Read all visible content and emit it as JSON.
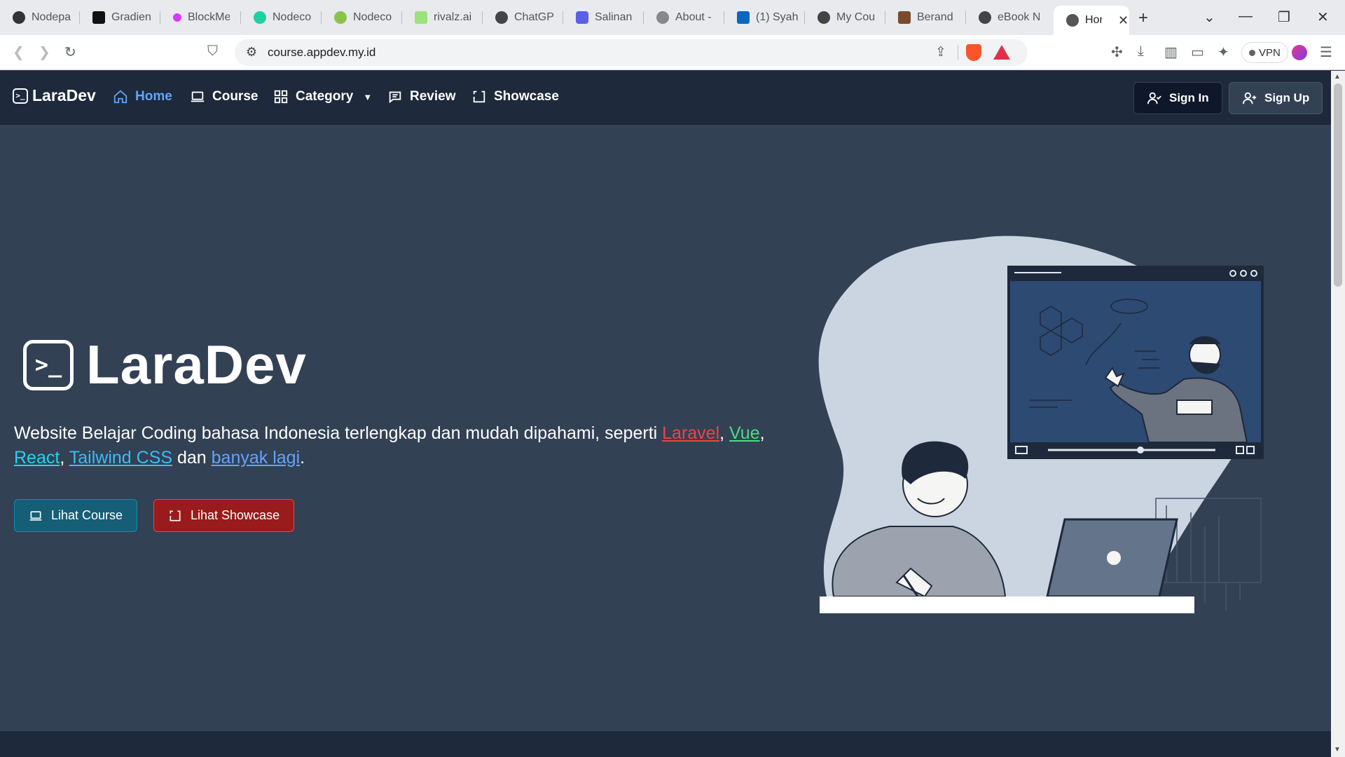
{
  "browser": {
    "tabs": [
      {
        "title": "Nodepa",
        "color": "#333333"
      },
      {
        "title": "Gradien",
        "color": "#111111"
      },
      {
        "title": "BlockMe",
        "color": "#d63aff"
      },
      {
        "title": "Nodeco",
        "color": "#1dd1a1"
      },
      {
        "title": "Nodeco",
        "color": "#8bc34a"
      },
      {
        "title": "rivalz.ai",
        "color": "#9be27a"
      },
      {
        "title": "ChatGP",
        "color": "#444444"
      },
      {
        "title": "Salinan",
        "color": "#5b5fe8"
      },
      {
        "title": "About -",
        "color": "#666666"
      },
      {
        "title": "(1) Syah",
        "color": "#0a66c2"
      },
      {
        "title": "My Cou",
        "color": "#444444"
      },
      {
        "title": "Berand",
        "color": "#7a4b2a"
      },
      {
        "title": "eBook N",
        "color": "#444444"
      },
      {
        "title": "Hor",
        "color": "#444444"
      }
    ],
    "url": "course.appdev.my.id",
    "vpn_label": "VPN"
  },
  "nav": {
    "brand": "LaraDev",
    "brand_mark": ">_",
    "items": [
      {
        "label": "Home",
        "icon": "home-icon"
      },
      {
        "label": "Course",
        "icon": "laptop-icon"
      },
      {
        "label": "Category",
        "icon": "grid-icon"
      },
      {
        "label": "Review",
        "icon": "chat-icon"
      },
      {
        "label": "Showcase",
        "icon": "frame-icon"
      }
    ],
    "sign_in": "Sign In",
    "sign_up": "Sign Up"
  },
  "hero": {
    "title": "LaraDev",
    "logo_mark": ">_",
    "desc_before": "Website Belajar Coding bahasa Indonesia terlengkap dan mudah dipahami, seperti ",
    "links": {
      "laravel": "Laravel",
      "vue": "Vue",
      "react": "React",
      "tailwind": "Tailwind CSS",
      "more": "banyak lagi"
    },
    "comma": ",",
    "dan": " dan ",
    "period": ".",
    "btn_course": "Lihat Course",
    "btn_showcase": "Lihat Showcase"
  },
  "colors": {
    "navbar": "#1e293b",
    "page_bg": "#334155",
    "active_link": "#60a5fa",
    "laravel": "#ef4444",
    "vue": "#4ade80",
    "react": "#22d3ee",
    "btn_course": "#155e75",
    "btn_showcase": "#991b1b"
  }
}
